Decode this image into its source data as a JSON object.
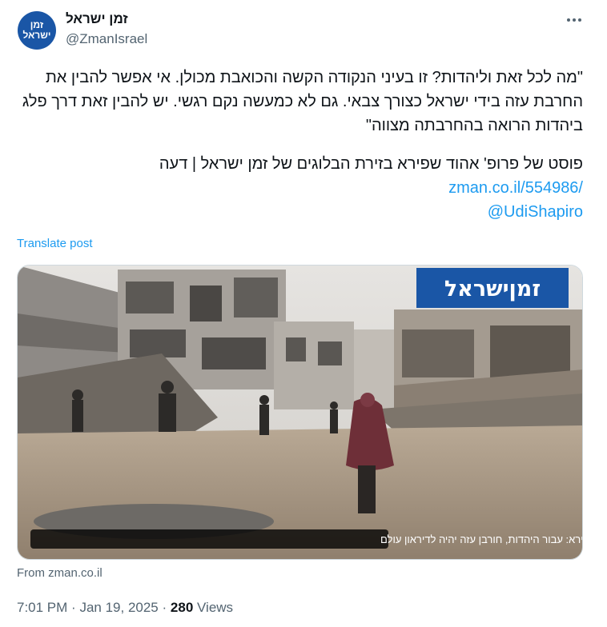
{
  "account": {
    "name": "זמן ישראל",
    "handle": "@ZmanIsrael",
    "avatar_line1": "זמן",
    "avatar_line2": "ישראל"
  },
  "icons": {
    "more": "more-horizontal-icon"
  },
  "tweet": {
    "quote": "\"מה לכל זאת וליהדות? זו בעיני הנקודה הקשה והכואבת מכולן. אי אפשר להבין את החרבת עזה בידי ישראל כצורך צבאי. גם לא כמעשה נקם רגשי. יש להבין זאת דרך פלג ביהדות הרואה בהחרבתה מצווה\"",
    "post_line": "פוסט של פרופ' אהוד שפירא בזירת הבלוגים של זמן ישראל | דעה",
    "link": "zman.co.il/554986/",
    "mention": "@UdiShapiro"
  },
  "translate": "Translate post",
  "card": {
    "logo": "זמןישראל",
    "caption": "פרופ' אהוד שפירא: עבור היהדות, חורבן עזה יהיה לדיראון עולם"
  },
  "from": "From zman.co.il",
  "meta": {
    "time": "7:01 PM",
    "sep1": "·",
    "date": "Jan 19, 2025",
    "sep2": "·",
    "views_count": "280",
    "views_label": "Views"
  },
  "colors": {
    "brand": "#1a56a6",
    "link": "#1d9bf0",
    "secondary": "#536471"
  }
}
